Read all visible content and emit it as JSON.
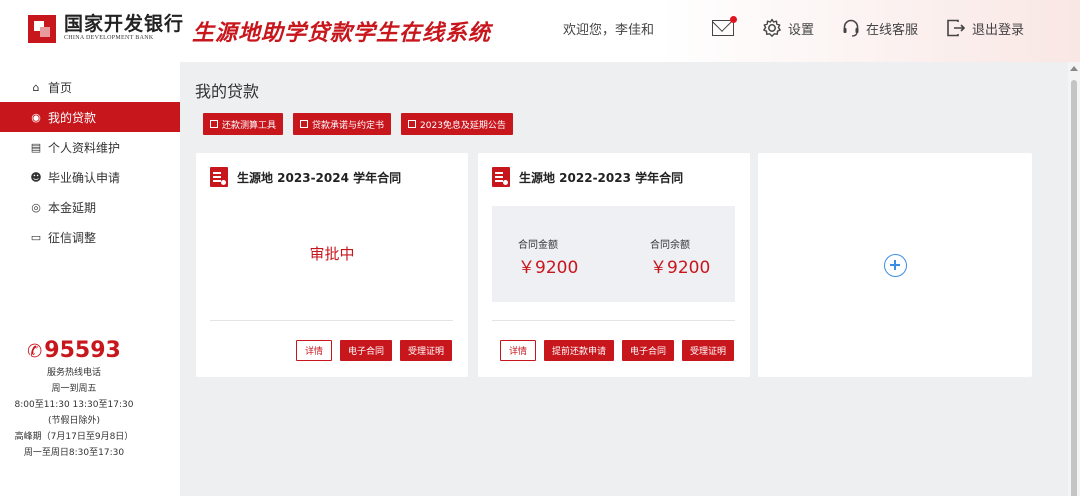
{
  "header": {
    "logo_cn": "国家开发银行",
    "logo_en": "CHINA DEVELOPMENT BANK",
    "system_title": "生源地助学贷款学生在线系统",
    "welcome": "欢迎您，李佳和",
    "settings_label": "设置",
    "service_label": "在线客服",
    "logout_label": "退出登录",
    "icons": [
      "mail-icon",
      "gear-icon",
      "headset-icon",
      "logout-icon"
    ]
  },
  "sidebar": {
    "items": [
      {
        "label": "首页",
        "icon": "home-icon",
        "active": false
      },
      {
        "label": "我的贷款",
        "icon": "loan-icon",
        "active": true
      },
      {
        "label": "个人资料维护",
        "icon": "profile-icon",
        "active": false
      },
      {
        "label": "毕业确认申请",
        "icon": "user-icon",
        "active": false
      },
      {
        "label": "本金延期",
        "icon": "clock-icon",
        "active": false
      },
      {
        "label": "征信调整",
        "icon": "card-icon",
        "active": false
      }
    ],
    "hotline": {
      "number": "95593",
      "lines": [
        "服务热线电话",
        "周一到周五",
        "8:00至11:30 13:30至17:30",
        "(节假日除外)",
        "高峰期（7月17日至9月8日）",
        "周一至周日8:30至17:30"
      ]
    }
  },
  "main": {
    "title": "我的贷款",
    "toolbar": [
      "还款测算工具",
      "贷款承诺与约定书",
      "2023免息及延期公告"
    ],
    "cards": [
      {
        "title": "生源地 2023-2024 学年合同",
        "status": "审批中",
        "actions": [
          "详情",
          "电子合同",
          "受理证明"
        ]
      },
      {
        "title": "生源地 2022-2023 学年合同",
        "amount_label": "合同金额",
        "amount_value": "￥9200",
        "balance_label": "合同余额",
        "balance_value": "￥9200",
        "actions": [
          "详情",
          "提前还款申请",
          "电子合同",
          "受理证明"
        ]
      }
    ]
  },
  "colors": {
    "brand": "#c8161d",
    "accent_blue": "#3a8ee6",
    "background": "#eeeff1"
  }
}
